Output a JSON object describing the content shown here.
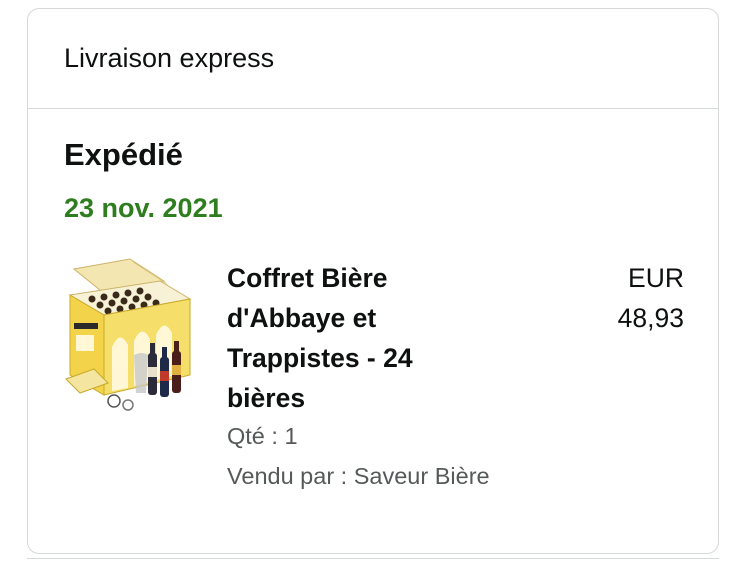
{
  "delivery": {
    "method": "Livraison express"
  },
  "shipment": {
    "status": "Expédié",
    "date": "23 nov. 2021"
  },
  "item": {
    "title": "Coffret Bière d'Abbaye et Trappistes - 24 bières",
    "price_currency": "EUR",
    "price_value": "48,93",
    "quantity": "Qté : 1",
    "seller": "Vendu par : Saveur Bière",
    "image_icon": "beer-gift-box-icon",
    "image_label": "ABBAYE"
  },
  "colors": {
    "date_green": "#2e7d1f",
    "border": "#d5d9d9",
    "secondary_text": "#565959"
  }
}
